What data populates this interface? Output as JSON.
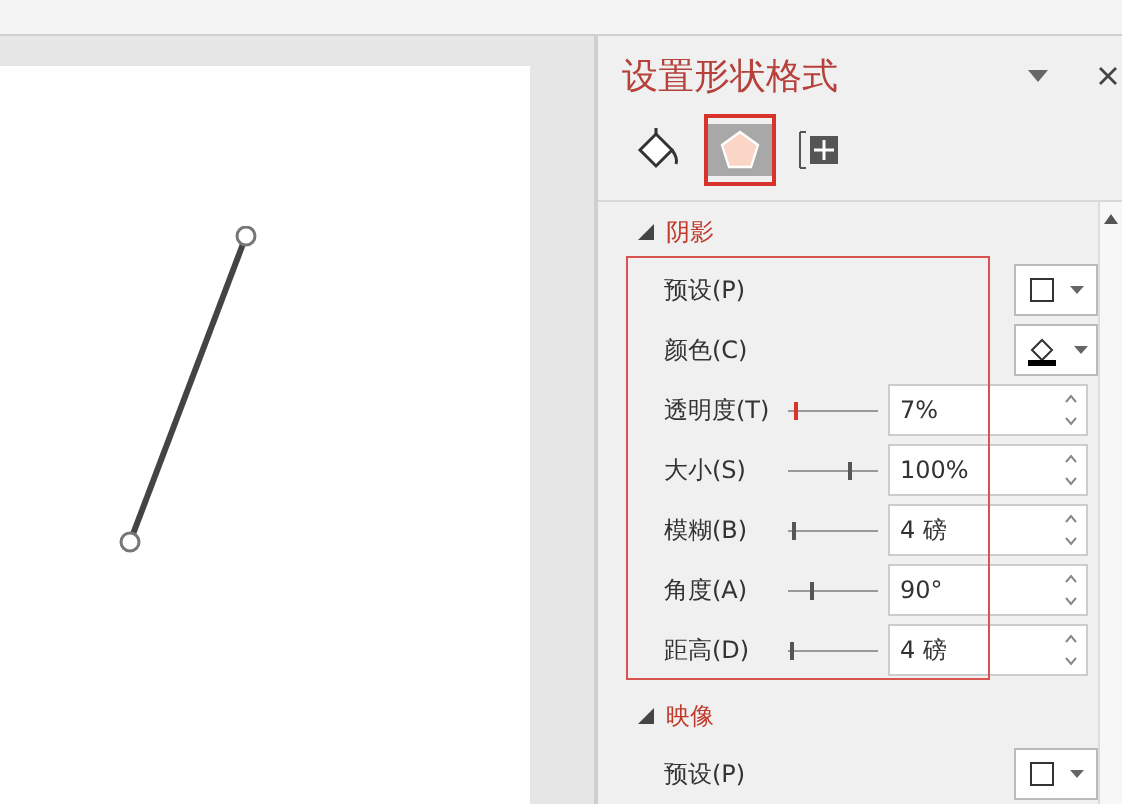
{
  "panel": {
    "title": "设置形状格式",
    "tabs": [
      {
        "selected": false
      },
      {
        "selected": true
      },
      {
        "selected": false
      }
    ],
    "sections": [
      {
        "title": "阴影",
        "expanded": true,
        "highlighted": true,
        "rows": [
          {
            "kind": "preset",
            "label": "预设(P)"
          },
          {
            "kind": "color",
            "label": "颜色(C)"
          },
          {
            "kind": "slider",
            "label": "透明度(T)",
            "level": 0.07,
            "value": "7%",
            "accent": true
          },
          {
            "kind": "slider",
            "label": "大小(S)",
            "level": 0.67,
            "value": "100%",
            "accent": false
          },
          {
            "kind": "slider",
            "label": "模糊(B)",
            "level": 0.04,
            "value": "4 磅",
            "accent": false
          },
          {
            "kind": "slider",
            "label": "角度(A)",
            "level": 0.25,
            "value": "90°",
            "accent": false
          },
          {
            "kind": "slider",
            "label": "距高(D)",
            "level": 0.03,
            "value": "4 磅",
            "accent": false
          }
        ]
      },
      {
        "title": "映像",
        "expanded": true,
        "highlighted": false,
        "rows": [
          {
            "kind": "preset",
            "label": "预设(P)"
          }
        ]
      }
    ]
  }
}
